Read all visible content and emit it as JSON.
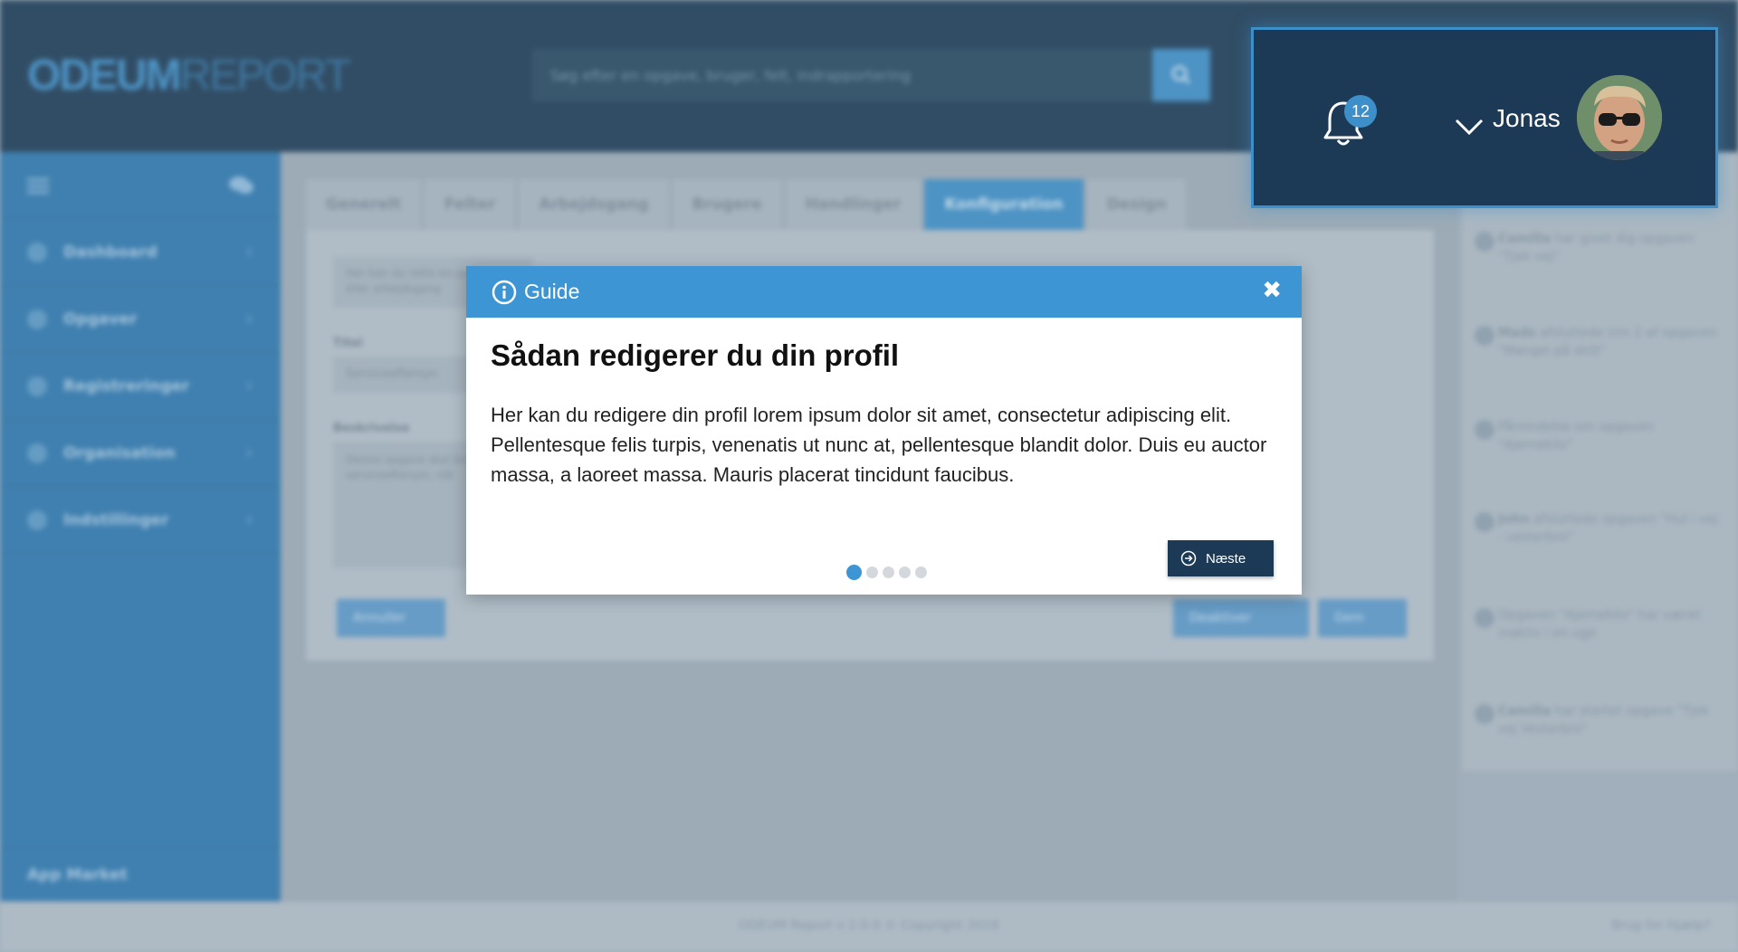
{
  "brand": {
    "logo_part1": "ODEUM",
    "logo_part2": "REPORT"
  },
  "search": {
    "placeholder": "Søg efter en opgave, bruger, felt, indrapportering"
  },
  "user": {
    "name": "Jonas",
    "notification_count": "12"
  },
  "sidebar": {
    "items": [
      {
        "label": "Dashboard"
      },
      {
        "label": "Opgaver"
      },
      {
        "label": "Registreringer"
      },
      {
        "label": "Organisation"
      },
      {
        "label": "Indstillinger"
      }
    ],
    "bottom": "App Market"
  },
  "tabs": [
    "Generelt",
    "Felter",
    "Arbejdsgang",
    "Brugere",
    "Handlinger",
    "Konfiguration",
    "Design"
  ],
  "form": {
    "intro": "Her kan du rette en opgave eller arbejdsgang",
    "title_label": "Titel",
    "title_value": "Serviceeftersyn",
    "desc_label": "Beskrivelse",
    "desc_value": "Denne opgave skal bruges til serviceeftersyn, når",
    "cancel": "Annuller",
    "deactivate": "Deaktiver",
    "save": "Gem"
  },
  "activity": [
    {
      "name": "Camilla",
      "text": "har givet dig opgaven \"Tjek vej\""
    },
    {
      "name": "Mads",
      "text": "afsluttede trin 2 af opgaven \"Mangel på skilt\""
    },
    {
      "name": "",
      "text": "Påmindelse om opgaven \"Ajernekilo\""
    },
    {
      "name": "John",
      "text": "afsluttede opgaven \"Hul i vej - vesterbro\""
    },
    {
      "name": "",
      "text": "Opgaven \"Ajernekilo\" har været inaktiv i en uge"
    },
    {
      "name": "Camilla",
      "text": "har startet opgave \"Tjek vej Vesterbro\""
    }
  ],
  "footer": {
    "copyright": "ODEUM Report v 2.0.0 © Copyright 2016",
    "help": "Brug for Hjælp?"
  },
  "guide": {
    "header": "Guide",
    "close": "✖",
    "title": "Sådan redigerer du din profil",
    "body": "Her kan du redigere din profil lorem ipsum dolor sit amet, consectetur adipiscing elit. Pellentesque felis turpis, venenatis ut nunc at, pellentesque blandit dolor. Duis eu auctor massa, a laoreet massa. Mauris placerat tincidunt faucibus.",
    "next": "Næste",
    "steps_total": 5,
    "step_current": 1
  },
  "colors": {
    "primary": "#3d95d4",
    "dark": "#1c3a55",
    "sidebar": "#2d78b0"
  }
}
